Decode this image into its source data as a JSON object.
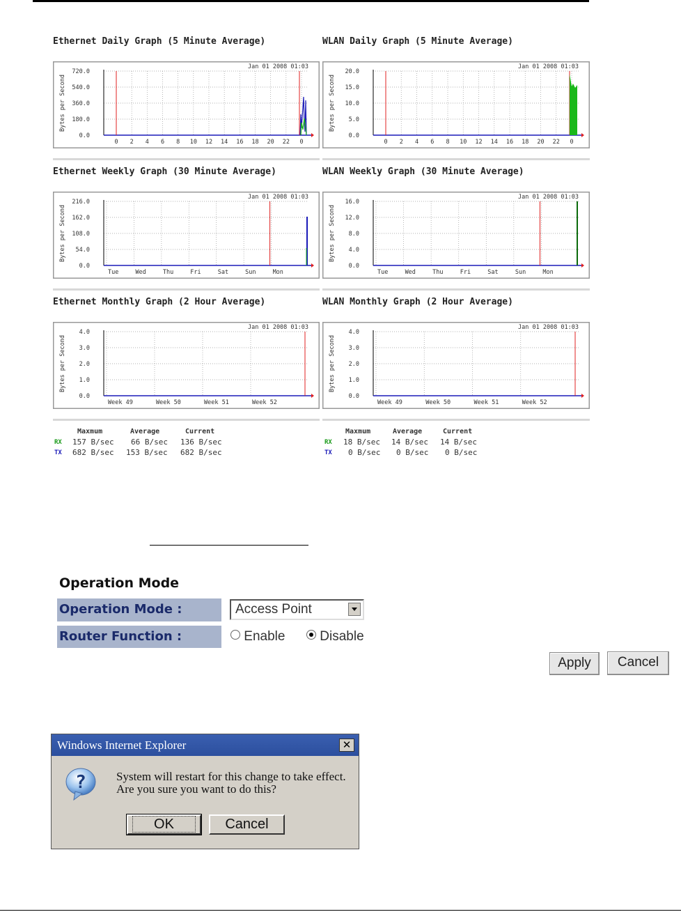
{
  "graphs": [
    {
      "title": "Ethernet Daily Graph (5 Minute Average)",
      "ylabel": "Bytes per Second",
      "yticks": [
        "720.0",
        "540.0",
        "360.0",
        "180.0",
        "0.0"
      ],
      "xticks": [
        "0",
        "2",
        "4",
        "6",
        "8",
        "10",
        "12",
        "14",
        "16",
        "18",
        "20",
        "22",
        "0"
      ],
      "timestamp": "Jan 01 2008 01:03"
    },
    {
      "title": "WLAN Daily Graph (5 Minute Average)",
      "ylabel": "Bytes per Second",
      "yticks": [
        "20.0",
        "15.0",
        "10.0",
        "5.0",
        "0.0"
      ],
      "xticks": [
        "0",
        "2",
        "4",
        "6",
        "8",
        "10",
        "12",
        "14",
        "16",
        "18",
        "20",
        "22",
        "0"
      ],
      "timestamp": "Jan 01 2008 01:03"
    },
    {
      "title": "Ethernet Weekly Graph (30 Minute Average)",
      "ylabel": "Bytes per Second",
      "yticks": [
        "216.0",
        "162.0",
        "108.0",
        "54.0",
        "0.0"
      ],
      "xticks": [
        "Tue",
        "Wed",
        "Thu",
        "Fri",
        "Sat",
        "Sun",
        "Mon"
      ],
      "timestamp": "Jan 01 2008 01:03"
    },
    {
      "title": "WLAN Weekly Graph (30 Minute Average)",
      "ylabel": "Bytes per Second",
      "yticks": [
        "16.0",
        "12.0",
        "8.0",
        "4.0",
        "0.0"
      ],
      "xticks": [
        "Tue",
        "Wed",
        "Thu",
        "Fri",
        "Sat",
        "Sun",
        "Mon"
      ],
      "timestamp": "Jan 01 2008 01:03"
    },
    {
      "title": "Ethernet Monthly Graph (2 Hour Average)",
      "ylabel": "Bytes per Second",
      "yticks": [
        "4.0",
        "3.0",
        "2.0",
        "1.0",
        "0.0"
      ],
      "xticks": [
        "Week 49",
        "Week 50",
        "Week 51",
        "Week 52"
      ],
      "timestamp": "Jan 01 2008 01:03"
    },
    {
      "title": "WLAN Monthly Graph (2 Hour Average)",
      "ylabel": "Bytes per Second",
      "yticks": [
        "4.0",
        "3.0",
        "2.0",
        "1.0",
        "0.0"
      ],
      "xticks": [
        "Week 49",
        "Week 50",
        "Week 51",
        "Week 52"
      ],
      "timestamp": "Jan 01 2008 01:03"
    }
  ],
  "stats": [
    {
      "headers": [
        "Maxmum",
        "Average",
        "Current"
      ],
      "rx": {
        "label": "RX",
        "max": "157 B/sec",
        "avg": "66 B/sec",
        "cur": "136 B/sec"
      },
      "tx": {
        "label": "TX",
        "max": "682 B/sec",
        "avg": "153 B/sec",
        "cur": "682 B/sec"
      }
    },
    {
      "headers": [
        "Maxmum",
        "Average",
        "Current"
      ],
      "rx": {
        "label": "RX",
        "max": "18 B/sec",
        "avg": "14 B/sec",
        "cur": "14 B/sec"
      },
      "tx": {
        "label": "TX",
        "max": "0 B/sec",
        "avg": "0 B/sec",
        "cur": "0 B/sec"
      }
    }
  ],
  "operation": {
    "title": "Operation Mode",
    "mode_label": "Operation Mode :",
    "mode_value": "Access Point",
    "router_label": "Router Function :",
    "enable_label": "Enable",
    "disable_label": "Disable",
    "router_selected": "Disable",
    "apply_label": "Apply",
    "cancel_label": "Cancel"
  },
  "dialog": {
    "title": "Windows Internet Explorer",
    "close_glyph": "✕",
    "line1": "System will restart for this change to take effect.",
    "line2": "Are you sure you want to do this?",
    "ok_label": "OK",
    "cancel_label": "Cancel"
  },
  "colors": {
    "rx": "#1ab81a",
    "tx": "#1a1ab8",
    "marker": "#e02020",
    "grid": "#999999",
    "axis": "#000000"
  }
}
